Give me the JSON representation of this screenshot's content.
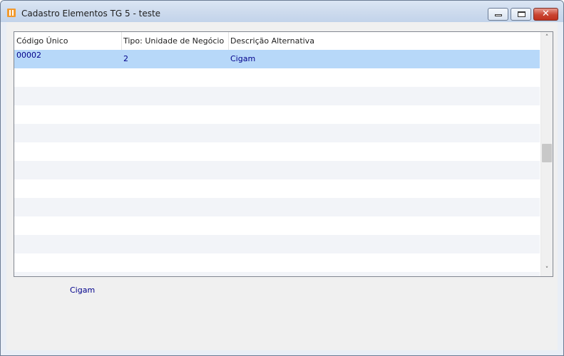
{
  "window": {
    "title": "Cadastro Elementos TG 5 - teste",
    "close_glyph": "✕"
  },
  "grid": {
    "columns": [
      "Código Único",
      "Tipo: Unidade de Negócio",
      "Descrição Alternativa"
    ],
    "rows": [
      {
        "codigo": "00002",
        "tipo": "2",
        "descricao": "Cigam"
      }
    ],
    "scroll_up_glyph": "˄",
    "scroll_down_glyph": "˅"
  },
  "footer": {
    "description": "Cigam"
  },
  "colors": {
    "selected_row": "#b7d8f9",
    "data_text": "#00008b"
  }
}
